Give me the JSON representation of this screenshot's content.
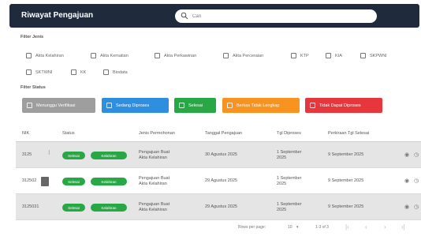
{
  "header": {
    "title": "Riwayat Pengajuan",
    "search_placeholder": "Cari"
  },
  "filter_jenis": {
    "label": "Filter Jenis",
    "items": [
      "Akta Kelahiran",
      "Akta Kematian",
      "Akta Perkawinan",
      "Akta Perceraian",
      "KTP",
      "KIA",
      "SKPWNI",
      "SKTWNI",
      "KK",
      "Biodata"
    ]
  },
  "filter_status": {
    "label": "Filter Status",
    "items": [
      {
        "label": "Menunggu Verifikasi",
        "color": "#9e9e9e"
      },
      {
        "label": "Sedang Diproses",
        "color": "#2e8fe0"
      },
      {
        "label": "Selesai",
        "color": "#28a745"
      },
      {
        "label": "Berkas Tidak Lengkap",
        "color": "#f7931e"
      },
      {
        "label": "Tidak Dapat Diproses",
        "color": "#e8363d"
      }
    ]
  },
  "table": {
    "headers": [
      "NIK",
      "Status",
      "Jenis Permohonan",
      "Tanggal Pengajuan",
      "Tgl Diproses",
      "Perkiraan Tgl Selesai"
    ],
    "rows": [
      {
        "nik": "3125",
        "status": "Selesai",
        "tag": "Kelahiran",
        "jenis1": "Pengajuan Buat",
        "jenis2": "Akta Kelahiran",
        "tanggal": "30 Agustus 2025",
        "proses1": "1 September",
        "proses2": "2025",
        "selesai": "9 September 2025"
      },
      {
        "nik": "312502",
        "status": "Selesai",
        "tag": "Kelahiran",
        "jenis1": "Pengajuan Buat",
        "jenis2": "Akta Kelahiran",
        "tanggal": "29 Agustus 2025",
        "proses1": "1 September",
        "proses2": "2025",
        "selesai": "9 September 2025"
      },
      {
        "nik": "3125031",
        "status": "Selesai",
        "tag": "Kelahiran",
        "jenis1": "Pengajuan Buat",
        "jenis2": "Akta Kelahiran",
        "tanggal": "29 Agustus 2025",
        "proses1": "1 September",
        "proses2": "2025",
        "selesai": "9 September 2025"
      }
    ]
  },
  "pagination": {
    "rows_per_page_label": "Rows per page:",
    "rows_per_page": "10",
    "range": "1-3 of 3"
  }
}
